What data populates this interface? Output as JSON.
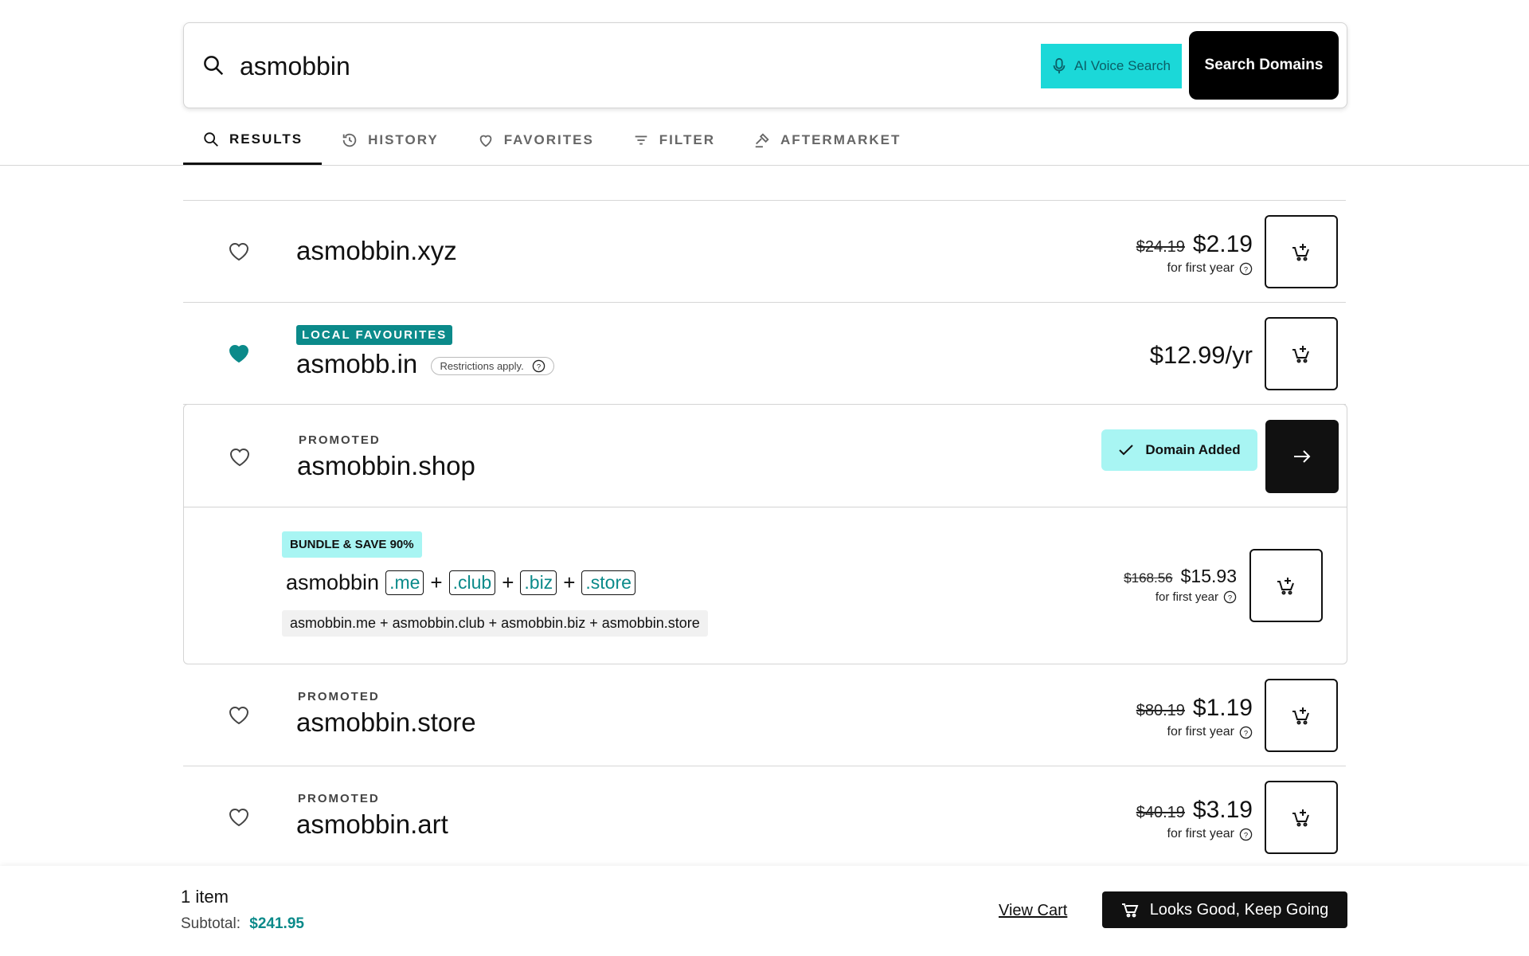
{
  "search": {
    "query": "asmobbin",
    "voice_label": "AI Voice Search",
    "submit_label": "Search Domains"
  },
  "tabs": [
    {
      "label": "RESULTS"
    },
    {
      "label": "HISTORY"
    },
    {
      "label": "FAVORITES"
    },
    {
      "label": "FILTER"
    },
    {
      "label": "AFTERMARKET"
    }
  ],
  "results": [
    {
      "domain": "asmobbin.xyz",
      "old_price": "$24.19",
      "price": "$2.19",
      "term": "for first year",
      "favorited": false
    },
    {
      "domain": "asmobb.in",
      "badge": "LOCAL FAVOURITES",
      "restriction": "Restrictions apply.",
      "price": "$12.99/yr",
      "favorited": true
    },
    {
      "domain": "asmobbin.shop",
      "tag": "PROMOTED",
      "status": "Domain Added",
      "favorited": false
    },
    {
      "domain": "asmobbin.store",
      "tag": "PROMOTED",
      "old_price": "$80.19",
      "price": "$1.19",
      "term": "for first year",
      "favorited": false
    },
    {
      "domain": "asmobbin.art",
      "tag": "PROMOTED",
      "old_price": "$40.19",
      "price": "$3.19",
      "term": "for first year",
      "favorited": false
    }
  ],
  "bundle": {
    "badge": "BUNDLE & SAVE 90%",
    "base": "asmobbin",
    "tlds": [
      ".me",
      ".club",
      ".biz",
      ".store"
    ],
    "plus": "+",
    "full_list": "asmobbin.me + asmobbin.club + asmobbin.biz + asmobbin.store",
    "old_price": "$168.56",
    "price": "$15.93",
    "term": "for first year"
  },
  "footer": {
    "items": "1 item",
    "subtotal_label": "Subtotal:",
    "subtotal_value": "$241.95",
    "view_cart": "View Cart",
    "continue_label": "Looks Good, Keep Going"
  },
  "colors": {
    "accent": "#0b8a8a",
    "voice_bg": "#1bd8d8",
    "added_bg": "#a8f5f3"
  }
}
